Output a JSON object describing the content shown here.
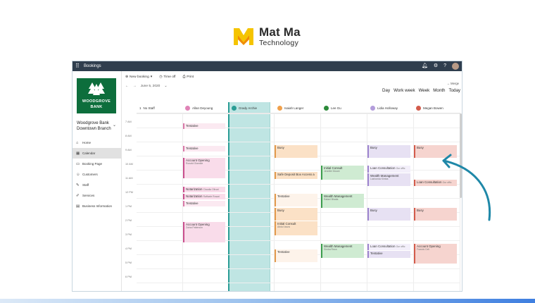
{
  "brand": {
    "name": "Mat Ma",
    "sub": "Technology"
  },
  "app": {
    "title": "Bookings"
  },
  "topbar_icons": [
    "bell-icon",
    "settings-icon",
    "help-icon",
    "avatar"
  ],
  "sidebar": {
    "logo_line1": "WOODGROVE",
    "logo_line2": "BANK",
    "business_name": "Woodgrove Bank Downtown Branch",
    "items": [
      {
        "label": "Home",
        "icon": "home-icon"
      },
      {
        "label": "Calendar",
        "icon": "calendar-icon"
      },
      {
        "label": "Booking Page",
        "icon": "booking-page-icon"
      },
      {
        "label": "Customers",
        "icon": "customers-icon"
      },
      {
        "label": "Staff",
        "icon": "staff-icon"
      },
      {
        "label": "Services",
        "icon": "services-icon"
      },
      {
        "label": "Business Information",
        "icon": "business-info-icon"
      }
    ]
  },
  "commands": {
    "new_booking": "New booking",
    "time_off": "Time off",
    "print": "Print"
  },
  "date": {
    "label": "June 5, 2020"
  },
  "views": {
    "merge": "Merge",
    "day": "Day",
    "work_week": "Work week",
    "week": "Week",
    "month": "Month",
    "today": "Today"
  },
  "columns": [
    {
      "label": "No Staff",
      "prefix": "1",
      "color": "#ffffff"
    },
    {
      "label": "Allan Deyoung",
      "color": "#e083b7"
    },
    {
      "label": "Grady Archie",
      "color": "#2a9d95"
    },
    {
      "label": "Isaiah Langer",
      "color": "#f0a04b"
    },
    {
      "label": "Lee Gu",
      "color": "#2c8a3a"
    },
    {
      "label": "Lidia Holloway",
      "color": "#b39ddb"
    },
    {
      "label": "Megan Bowen",
      "color": "#d35b4b"
    }
  ],
  "times": [
    "7 AM",
    "8 AM",
    "9 AM",
    "10 AM",
    "11 AM",
    "12 PM",
    "1 PM",
    "2 PM",
    "3 PM",
    "4 PM",
    "5 PM",
    "6 PM"
  ],
  "events": [
    {
      "title": "Tentative",
      "sub": ""
    },
    {
      "title": "Tentative",
      "sub": ""
    },
    {
      "title": "Account Opening",
      "sub": "Ronald Olamide"
    },
    {
      "title": "Notarization",
      "sub": "Claudia Olivari"
    },
    {
      "title": "Notarization",
      "sub": "Raffaele Rosari"
    },
    {
      "title": "Tentative",
      "sub": ""
    },
    {
      "title": "Account Opening",
      "sub": "Zaina Patterson"
    },
    {
      "title": "Busy",
      "sub": ""
    },
    {
      "title": "Safe Deposit Box Access a",
      "sub": ""
    },
    {
      "title": "Tentative",
      "sub": ""
    },
    {
      "title": "Busy",
      "sub": ""
    },
    {
      "title": "Initial Consult",
      "sub": "Abdul Izaza"
    },
    {
      "title": "Tentative",
      "sub": ""
    },
    {
      "title": "Initial Consult",
      "sub": "Jennifer Moore"
    },
    {
      "title": "Wealth Management",
      "sub": "Rafael Bhatia"
    },
    {
      "title": "Wealth Management",
      "sub": "Simba Reza"
    },
    {
      "title": "Busy",
      "sub": ""
    },
    {
      "title": "Loan Consultation",
      "sub": "Our offic"
    },
    {
      "title": "Wealth Management",
      "sub": "Lashonda Kimba"
    },
    {
      "title": "Busy",
      "sub": ""
    },
    {
      "title": "Loan Consultation",
      "sub": "Our offic"
    },
    {
      "title": "Tentative",
      "sub": ""
    },
    {
      "title": "Busy",
      "sub": ""
    },
    {
      "title": "Loan Consultation",
      "sub": "Our offic"
    },
    {
      "title": "Busy",
      "sub": ""
    },
    {
      "title": "Account Opening",
      "sub": "Francis Celi"
    }
  ],
  "colors": {
    "accent": "#2a9d95",
    "topbar": "#2f3e4e",
    "bank_green": "#0d6e3c",
    "arrow": "#1f88a8"
  }
}
